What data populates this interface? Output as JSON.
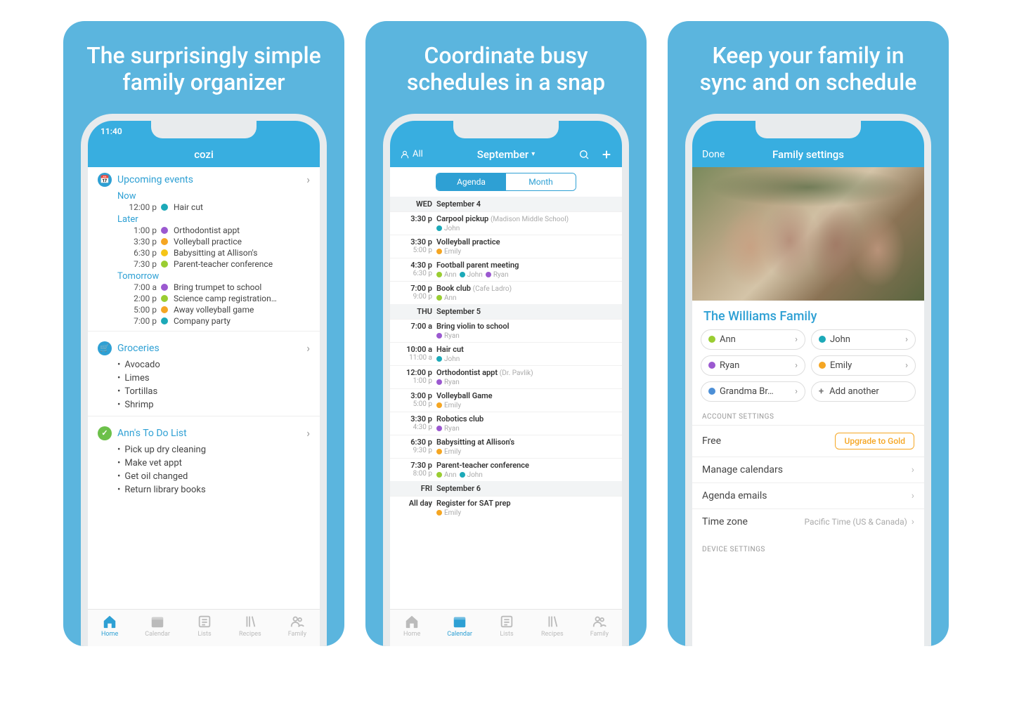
{
  "panels": [
    {
      "title": "The surprisingly simple family organizer"
    },
    {
      "title": "Coordinate busy schedules in a snap"
    },
    {
      "title": "Keep your family in sync and on schedule"
    }
  ],
  "statusbar": {
    "time": "11:40"
  },
  "brand": "cozi",
  "screen1": {
    "upcoming": {
      "header": "Upcoming events",
      "groups": [
        {
          "label": "Now",
          "items": [
            {
              "time": "12:00 p",
              "color": "d-teal",
              "title": "Hair cut"
            }
          ]
        },
        {
          "label": "Later",
          "items": [
            {
              "time": "1:00 p",
              "color": "d-purple",
              "title": "Orthodontist appt"
            },
            {
              "time": "3:30 p",
              "color": "d-orange",
              "title": "Volleyball practice"
            },
            {
              "time": "6:30 p",
              "color": "d-yellow",
              "title": "Babysitting at Allison's"
            },
            {
              "time": "7:30 p",
              "color": "d-lime",
              "title": "Parent-teacher conference"
            }
          ]
        },
        {
          "label": "Tomorrow",
          "items": [
            {
              "time": "7:00 a",
              "color": "d-purple",
              "title": "Bring trumpet to school"
            },
            {
              "time": "2:00 p",
              "color": "d-lime",
              "title": "Science camp registration…"
            },
            {
              "time": "5:00 p",
              "color": "d-orange",
              "title": "Away volleyball game"
            },
            {
              "time": "7:00 p",
              "color": "d-teal",
              "title": "Company party"
            }
          ]
        }
      ]
    },
    "groceries": {
      "header": "Groceries",
      "items": [
        "Avocado",
        "Limes",
        "Tortillas",
        "Shrimp"
      ]
    },
    "todo": {
      "header": "Ann's To Do List",
      "items": [
        "Pick up dry cleaning",
        "Make vet appt",
        "Get oil changed",
        "Return library books"
      ]
    },
    "tabs": [
      "Home",
      "Calendar",
      "Lists",
      "Recipes",
      "Family"
    ],
    "active_tab": 0
  },
  "screen2": {
    "filter": "All",
    "month": "September",
    "segs": [
      "Agenda",
      "Month"
    ],
    "active_seg": 0,
    "days": [
      {
        "dow": "WED",
        "date": "September 4",
        "events": [
          {
            "t1": "3:30 p",
            "t2": "",
            "title": "Carpool pickup",
            "loc": "(Madison Middle School)",
            "people": [
              {
                "c": "d-teal",
                "n": "John"
              }
            ]
          },
          {
            "t1": "3:30 p",
            "t2": "5:00 p",
            "title": "Volleyball practice",
            "loc": "",
            "people": [
              {
                "c": "d-orange",
                "n": "Emily"
              }
            ]
          },
          {
            "t1": "4:30 p",
            "t2": "6:30 p",
            "title": "Football parent meeting",
            "loc": "",
            "people": [
              {
                "c": "d-lime",
                "n": "Ann"
              },
              {
                "c": "d-teal",
                "n": "John"
              },
              {
                "c": "d-purple",
                "n": "Ryan"
              }
            ]
          },
          {
            "t1": "7:00 p",
            "t2": "9:00 p",
            "title": "Book club",
            "loc": "(Cafe Ladro)",
            "people": [
              {
                "c": "d-lime",
                "n": "Ann"
              }
            ]
          }
        ]
      },
      {
        "dow": "THU",
        "date": "September 5",
        "events": [
          {
            "t1": "7:00 a",
            "t2": "",
            "title": "Bring violin to school",
            "loc": "",
            "people": [
              {
                "c": "d-purple",
                "n": "Ryan"
              }
            ]
          },
          {
            "t1": "10:00 a",
            "t2": "11:00 a",
            "title": "Hair cut",
            "loc": "",
            "people": [
              {
                "c": "d-teal",
                "n": "John"
              }
            ]
          },
          {
            "t1": "12:00 p",
            "t2": "1:00 p",
            "title": "Orthodontist appt",
            "loc": "(Dr. Pavlik)",
            "people": [
              {
                "c": "d-purple",
                "n": "Ryan"
              }
            ]
          },
          {
            "t1": "3:00 p",
            "t2": "5:00 p",
            "title": "Volleyball Game",
            "loc": "",
            "people": [
              {
                "c": "d-orange",
                "n": "Emily"
              }
            ]
          },
          {
            "t1": "3:30 p",
            "t2": "4:30 p",
            "title": "Robotics club",
            "loc": "",
            "people": [
              {
                "c": "d-purple",
                "n": "Ryan"
              }
            ]
          },
          {
            "t1": "6:30 p",
            "t2": "9:30 p",
            "title": "Babysitting at Allison's",
            "loc": "",
            "people": [
              {
                "c": "d-orange",
                "n": "Emily"
              }
            ]
          },
          {
            "t1": "7:30 p",
            "t2": "8:00 p",
            "title": "Parent-teacher conference",
            "loc": "",
            "people": [
              {
                "c": "d-lime",
                "n": "Ann"
              },
              {
                "c": "d-teal",
                "n": "John"
              }
            ]
          }
        ]
      },
      {
        "dow": "FRI",
        "date": "September 6",
        "events": [
          {
            "t1": "All day",
            "t2": "",
            "title": "Register for SAT prep",
            "loc": "",
            "people": [
              {
                "c": "d-orange",
                "n": "Emily"
              }
            ]
          }
        ]
      }
    ],
    "tabs": [
      "Home",
      "Calendar",
      "Lists",
      "Recipes",
      "Family"
    ],
    "active_tab": 1
  },
  "screen3": {
    "done": "Done",
    "title": "Family settings",
    "family_name": "The Williams Family",
    "members": [
      {
        "color": "d-lime",
        "name": "Ann"
      },
      {
        "color": "d-teal",
        "name": "John"
      },
      {
        "color": "d-purple",
        "name": "Ryan"
      },
      {
        "color": "d-orange",
        "name": "Emily"
      },
      {
        "color": "d-blue2",
        "name": "Grandma Br…"
      }
    ],
    "add_another": "Add another",
    "account_header": "ACCOUNT SETTINGS",
    "plan_label": "Free",
    "upgrade": "Upgrade to Gold",
    "rows": [
      {
        "label": "Manage calendars",
        "val": ""
      },
      {
        "label": "Agenda emails",
        "val": ""
      },
      {
        "label": "Time zone",
        "val": "Pacific Time (US & Canada)"
      }
    ],
    "device_header": "DEVICE SETTINGS"
  }
}
